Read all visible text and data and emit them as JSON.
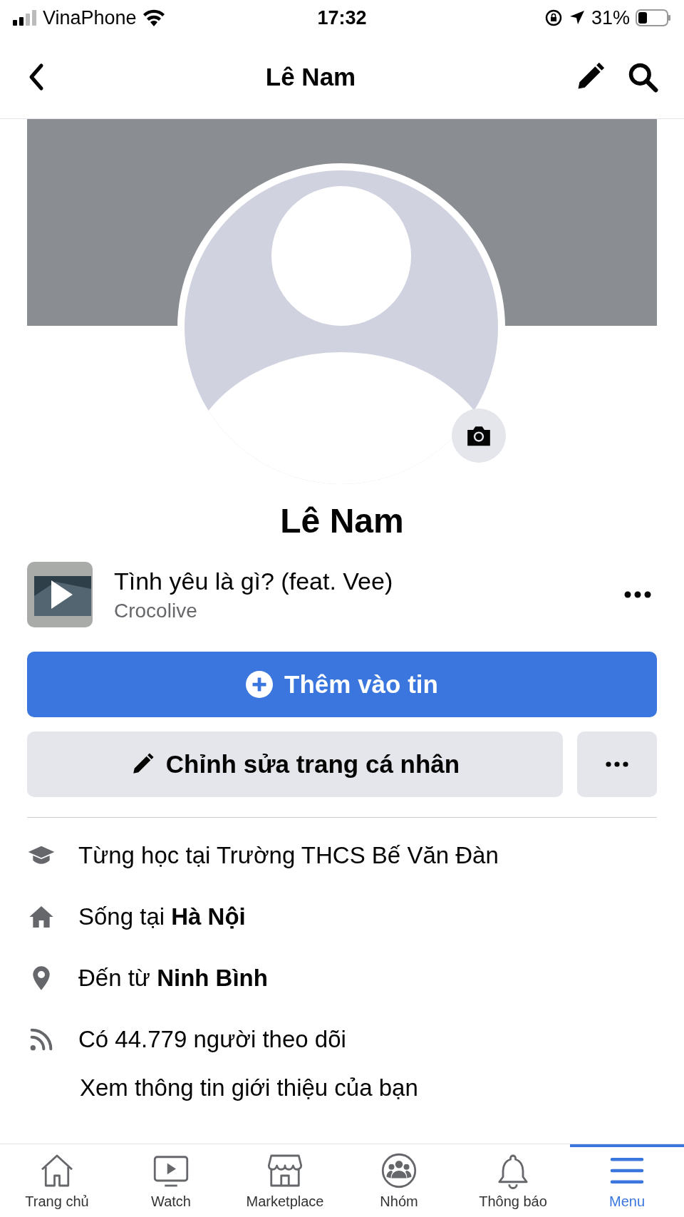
{
  "status_bar": {
    "carrier": "VinaPhone",
    "time": "17:32",
    "battery": "31%"
  },
  "header": {
    "title": "Lê Nam"
  },
  "profile": {
    "name": "Lê Nam"
  },
  "music": {
    "title": "Tình yêu là gì? (feat. Vee)",
    "artist": "Crocolive"
  },
  "buttons": {
    "add_story": "Thêm vào tin",
    "edit_profile": "Chỉnh sửa trang cá nhân"
  },
  "info": [
    {
      "kind": "school",
      "text": "Từng học tại Trường THCS Bế Văn Đàn"
    },
    {
      "kind": "home",
      "text": "Sống tại **Hà Nội**"
    },
    {
      "kind": "pin",
      "text": "Đến từ **Ninh Bình**"
    },
    {
      "kind": "followers",
      "text": "Có 44.779 người theo dõi"
    }
  ],
  "see_about": "Xem thông tin giới thiệu của bạn",
  "tabs": [
    {
      "kind": "home",
      "label": "Trang chủ",
      "selected": false
    },
    {
      "kind": "watch",
      "label": "Watch",
      "selected": false
    },
    {
      "kind": "market",
      "label": "Marketplace",
      "selected": false
    },
    {
      "kind": "groups",
      "label": "Nhóm",
      "selected": false
    },
    {
      "kind": "bell",
      "label": "Thông báo",
      "selected": false
    },
    {
      "kind": "menu",
      "label": "Menu",
      "selected": true
    }
  ]
}
